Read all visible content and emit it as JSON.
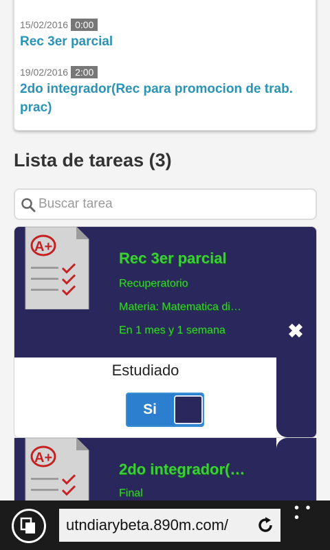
{
  "events": [
    {
      "date": "15/02/2016",
      "time": "0:00",
      "title": "Rec 3er parcial"
    },
    {
      "date": "19/02/2016",
      "time": "2:00",
      "title": "2do integrador(Rec para promocion de trab. prac)"
    }
  ],
  "tasks_section": {
    "title": "Lista de tareas (3)"
  },
  "search": {
    "placeholder": "Buscar tarea"
  },
  "tasks": [
    {
      "title": "Rec 3er parcial",
      "type": "Recuperatorio",
      "subject": "Materia: Matematica di…",
      "due": "En 1 mes y 1 semana",
      "status_label": "Estudiado",
      "toggle_label": "Si",
      "delete_label": "✖"
    },
    {
      "title": "2do integrador(…",
      "type": "Final"
    }
  ],
  "browser": {
    "url": "utndiarybeta.890m.com/",
    "more_label": "• • •"
  },
  "colors": {
    "card_bg": "#29275b",
    "title_green": "#3ecc3e",
    "link_blue": "#2a93b6",
    "toggle_blue": "#2c7fcf"
  }
}
